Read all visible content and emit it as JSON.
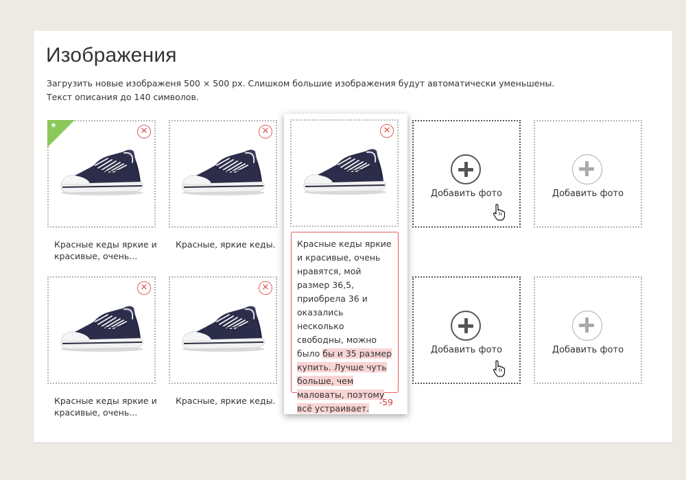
{
  "page": {
    "title": "Изображения",
    "desc_line1": "Загрузить новые изображеня 500 × 500 px. Слишком большие изображения будут автоматически уменьшены.",
    "desc_line2": "Текст описания до 140 символов."
  },
  "colors": {
    "background": "#edeae4",
    "remove": "#e05050",
    "main_badge": "#8ac85a",
    "over_limit_highlight": "#f9d4d4",
    "counter": "#d23b3b"
  },
  "icons": {
    "remove": "close-circle-icon",
    "main": "star-icon",
    "add": "plus-circle-icon",
    "cursor": "hand-pointer-icon"
  },
  "images": [
    {
      "caption": "Красные кеды яркие и красивые, очень...",
      "main": true
    },
    {
      "caption": "Красные, яркие кеды.",
      "main": false
    },
    {
      "caption": "Красные кеды яркие и красивые, очень...",
      "main": false
    },
    {
      "caption": "Красные, яркие кеды.",
      "main": false
    }
  ],
  "remove_symbol": "✕",
  "star_symbol": "★",
  "add_slots": [
    {
      "label": "Добавить фото"
    },
    {
      "label": "Добавить фото"
    },
    {
      "label": "Добавить фото"
    },
    {
      "label": "Добавить фото"
    }
  ],
  "editor": {
    "text_ok": "Красные кеды яркие и красивые, очень нравятся, мой размер 36,5, приобрела 36 и оказались несколько свободны, можно было ",
    "text_over": "бы и 35 размер купить. Лучше чуть больше, чем маловаты, поэтому всё устраивает.",
    "counter": "-59"
  }
}
